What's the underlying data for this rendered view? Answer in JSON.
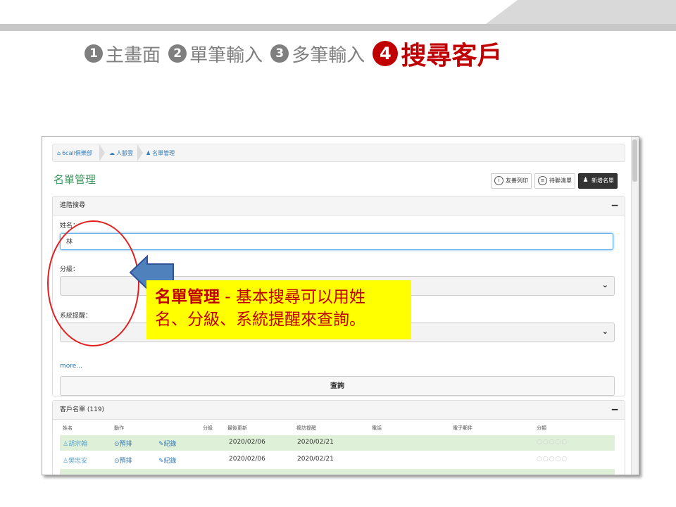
{
  "steps": [
    {
      "num": "1",
      "label": "主畫面",
      "active": false
    },
    {
      "num": "2",
      "label": "單筆輸入",
      "active": false
    },
    {
      "num": "3",
      "label": "多筆輸入",
      "active": false
    },
    {
      "num": "4",
      "label": "搜尋客戶",
      "active": true
    }
  ],
  "breadcrumb": [
    {
      "icon": "home-icon",
      "label": "6call俱樂部"
    },
    {
      "icon": "cloud-icon",
      "label": "人脈雲"
    },
    {
      "icon": "users-icon",
      "label": "名單管理"
    }
  ],
  "page": {
    "title": "名單管理"
  },
  "toolbar": {
    "print_label": "友善列印",
    "contact_label": "待聯清單",
    "add_label": "新增名單"
  },
  "search": {
    "header": "進階搜尋",
    "name_label": "姓名：",
    "name_value": "林",
    "level_label": "分級：",
    "reminder_label": "系統提醒：",
    "more_label": "more...",
    "query_label": "查詢"
  },
  "list": {
    "header": "客戶名單 (119)",
    "columns": [
      "姓名",
      "動作",
      "分級",
      "最後更新",
      "複訪提醒",
      "電話",
      "電子郵件",
      "分類"
    ],
    "rows": [
      {
        "name": "胡宗翰",
        "schedule": "預排",
        "record": "紀錄",
        "updated": "2020/02/06",
        "reminder": "2020/02/21"
      },
      {
        "name": "樊忠安",
        "schedule": "預排",
        "record": "紀錄",
        "updated": "2020/02/06",
        "reminder": "2020/02/21"
      }
    ]
  },
  "callout": {
    "title": "名單管理",
    "separator": " - ",
    "text_line1": "基本搜尋可以用姓",
    "text_line2": "名、分級、系統提醒來查詢。"
  },
  "colors": {
    "accent_red": "#c00000",
    "highlight": "#ffff00",
    "title_green": "#3c9a5f",
    "row_green": "#dff0d8"
  }
}
